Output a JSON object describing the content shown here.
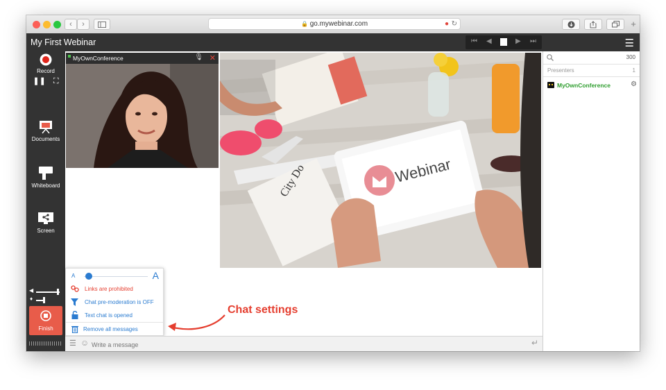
{
  "browser": {
    "url": "go.mywebinar.com",
    "nav_back": "‹",
    "nav_forward": "›"
  },
  "app": {
    "title": "My First Webinar"
  },
  "leftbar": {
    "record_label": "Record",
    "documents_label": "Documents",
    "whiteboard_label": "Whiteboard",
    "screen_label": "Screen",
    "finish_label": "Finish"
  },
  "video": {
    "participant": "MyOwnConference"
  },
  "slide": {
    "tablet_text": "Webinar",
    "magazine_title": "City Do"
  },
  "chat_settings": {
    "font_small": "A",
    "font_large": "A",
    "font_size_fraction": 0.0,
    "links": "Links are prohibited",
    "premoderation": "Chat pre-moderation is OFF",
    "text_chat": "Text chat is opened",
    "remove": "Remove all messages"
  },
  "chat": {
    "placeholder": "Write a message"
  },
  "participants": {
    "search_count": "300",
    "presenters_label": "Presenters",
    "presenters_count": "1",
    "presenter_name": "MyOwnConference"
  },
  "annotation": {
    "label": "Chat settings"
  },
  "colors": {
    "accent_red": "#e85c4a",
    "annotation_red": "#e53e2f",
    "presenter_green": "#2f9e2f",
    "link_blue": "#2a7bd0",
    "dark_bar": "#333333"
  }
}
